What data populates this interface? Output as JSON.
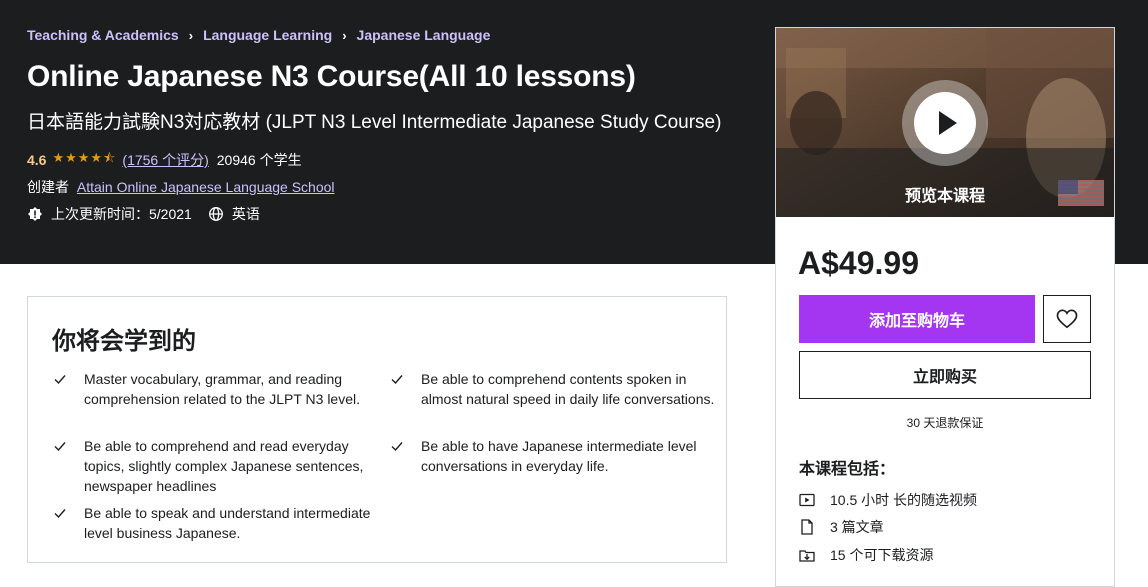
{
  "breadcrumb": [
    "Teaching & Academics",
    "Language Learning",
    "Japanese Language"
  ],
  "course": {
    "title": "Online Japanese N3 Course(All 10 lessons)",
    "subtitle": "日本語能力試験N3対応教材 (JLPT N3 Level Intermediate Japanese Study Course)",
    "rating": "4.6",
    "stars_value": 4.5,
    "rating_count": "(1756 个评分)",
    "students": "20946 个学生",
    "creator_label": "创建者",
    "creator": "Attain Online Japanese Language School",
    "updated": "上次更新时间：5/2021",
    "language": "英语"
  },
  "sidebar": {
    "preview_label": "预览本课程",
    "price": "A$49.99",
    "add_to_cart": "添加至购物车",
    "buy_now": "立即购买",
    "guarantee": "30 天退款保证",
    "includes_title": "本课程包括：",
    "includes": [
      {
        "icon": "video-icon",
        "text": "10.5 小时 长的随选视频"
      },
      {
        "icon": "article-icon",
        "text": "3 篇文章"
      },
      {
        "icon": "download-icon",
        "text": "15 个可下载资源"
      }
    ]
  },
  "learn": {
    "title": "你将会学到的",
    "items": [
      "Master vocabulary, grammar, and reading comprehension related to the JLPT N3 level.",
      "Be able to comprehend contents spoken in almost natural speed in daily life conversations.",
      "Be able to comprehend and read everyday topics, slightly complex Japanese sentences, newspaper headlines",
      "Be able to have Japanese intermediate level conversations in everyday life.",
      "Be able to speak and understand intermediate level business Japanese."
    ]
  },
  "colors": {
    "hero_bg": "#1c1d1f",
    "link_purple": "#cec0fc",
    "rating_orange": "#f3ca8c",
    "star": "#e59819",
    "cta_purple": "#a435f0"
  }
}
